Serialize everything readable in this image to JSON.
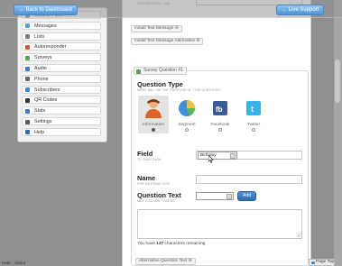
{
  "topbar": {
    "back_label": "← Back to Dashboard",
    "live_support_label": "← Live Support"
  },
  "header_fragment": {
    "for_internal_use": "FOR INTERNAL USE"
  },
  "sidebar": {
    "items": [
      {
        "label": "Control Panel",
        "icon": "control-panel-icon",
        "color": "#5a8fd1"
      },
      {
        "label": "Messages",
        "icon": "messages-icon",
        "color": "#4aa3df"
      },
      {
        "label": "Lists",
        "icon": "lists-icon",
        "color": "#7a7a7a"
      },
      {
        "label": "Autoresponder",
        "icon": "autoresponder-icon",
        "color": "#d35a3a"
      },
      {
        "label": "Surveys",
        "icon": "surveys-icon",
        "color": "#55a84a"
      },
      {
        "label": "Audio",
        "icon": "audio-icon",
        "color": "#3c7fc9"
      },
      {
        "label": "Phone",
        "icon": "phone-icon",
        "color": "#6a6a6a"
      },
      {
        "label": "Subscribers",
        "icon": "subscribers-icon",
        "color": "#3f8ad4"
      },
      {
        "label": "QR Codes",
        "icon": "qr-codes-icon",
        "color": "#333333"
      },
      {
        "label": "Stats",
        "icon": "stats-icon",
        "color": "#3d7bc4"
      },
      {
        "label": "Settings",
        "icon": "settings-icon",
        "color": "#5a5a5a"
      },
      {
        "label": "Help",
        "icon": "help-icon",
        "color": "#2e6fb7"
      }
    ]
  },
  "main": {
    "install_text_message_label": "Install Text Message ⊖",
    "install_text_alternative_label": "Install Text Message Alternative ⊖",
    "survey_question_tab": "Survey Question #1",
    "question_type": {
      "title": "Question Type",
      "subtitle": "WHAT WILL BE THE PURPOSE OF THIS QUESTION?",
      "options": [
        {
          "label": "Information",
          "icon": "information-person-icon",
          "selected": true
        },
        {
          "label": "Segment",
          "icon": "segment-pie-icon",
          "selected": false
        },
        {
          "label": "Facebook",
          "icon": "facebook-icon",
          "selected": false
        },
        {
          "label": "Twitter",
          "icon": "twitter-icon",
          "selected": false
        }
      ]
    },
    "field": {
      "title": "Field",
      "subtitle": "TO SAVE DATA",
      "value": "Birthday"
    },
    "name": {
      "title": "Name",
      "subtitle": "FOR INTERNAL USE",
      "value": ""
    },
    "question_text": {
      "title": "Question Text",
      "subtitle": "MAY CONTAIN TOKENS",
      "select_value": "",
      "add_label": "Add",
      "textarea_value": ""
    },
    "chars_remaining_prefix": "You have ",
    "chars_remaining_count": "137",
    "chars_remaining_suffix": " characters remaining",
    "alternative_question_text_label": "Alternative Question Text ⊖"
  },
  "footer": {
    "help": "Help",
    "about": "About",
    "page_top": "Page Top"
  },
  "colors": {
    "accent_blue": "#4c94d8",
    "add_button": "#2f6fb6"
  }
}
